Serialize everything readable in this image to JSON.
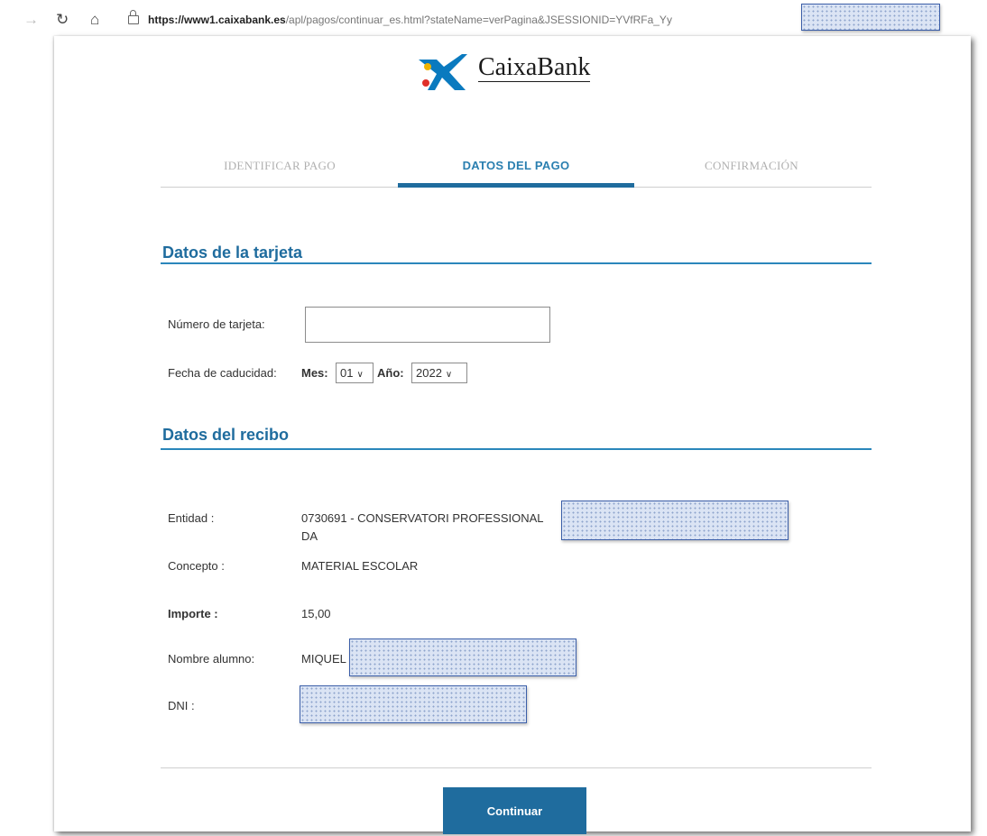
{
  "browser": {
    "url_domain": "https://www1.caixabank.es",
    "url_path": "/apl/pagos/continuar_es.html?stateName=verPagina&JSESSIONID=YVfRFa_Yy"
  },
  "logo": {
    "text": "CaixaBank",
    "icon": "caixabank-star-icon"
  },
  "steps": {
    "items": [
      "IDENTIFICAR PAGO",
      "DATOS DEL PAGO",
      "CONFIRMACIÓN"
    ],
    "active": "DATOS DEL PAGO"
  },
  "card_section": {
    "title": "Datos de la tarjeta",
    "card_number_label": "Número de tarjeta:",
    "card_number_value": "",
    "expiry_label": "Fecha de caducidad:",
    "month_label": "Mes:",
    "month_value": "01",
    "year_label": "Año:",
    "year_value": "2022"
  },
  "receipt_section": {
    "title": "Datos del recibo",
    "entity_label": "Entidad :",
    "entity_value_line1": "0730691 - CONSERVATORI PROFESSIONAL",
    "entity_value_line2": "DA",
    "concept_label": "Concepto :",
    "concept_value": "MATERIAL ESCOLAR",
    "amount_label": "Importe :",
    "amount_value": "15,00",
    "student_label": "Nombre alumno:",
    "student_value": "MIQUEL",
    "dni_label": "DNI :"
  },
  "actions": {
    "continue_label": "Continuar"
  },
  "colors": {
    "primary": "#1f6c9e",
    "section_line": "#2a86bb",
    "redaction": "#dbe4f4"
  }
}
